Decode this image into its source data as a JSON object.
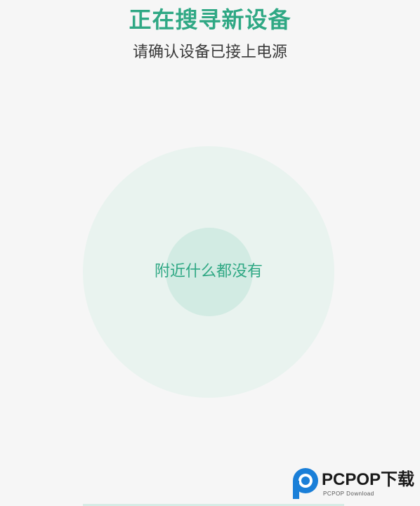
{
  "header": {
    "title": "正在搜寻新设备",
    "subtitle": "请确认设备已接上电源"
  },
  "radar": {
    "empty_text": "附近什么都没有"
  },
  "watermark": {
    "brand": "PCPOP下载",
    "tagline": "PCPOP Download",
    "logo_icon": "pcpop-logo-icon"
  },
  "colors": {
    "accent": "#2fa884",
    "background": "#f6f6f6",
    "radar_outer": "#e9f3ef",
    "radar_inner": "#d2ebe3",
    "subtitle_text": "#3a3a3a"
  }
}
